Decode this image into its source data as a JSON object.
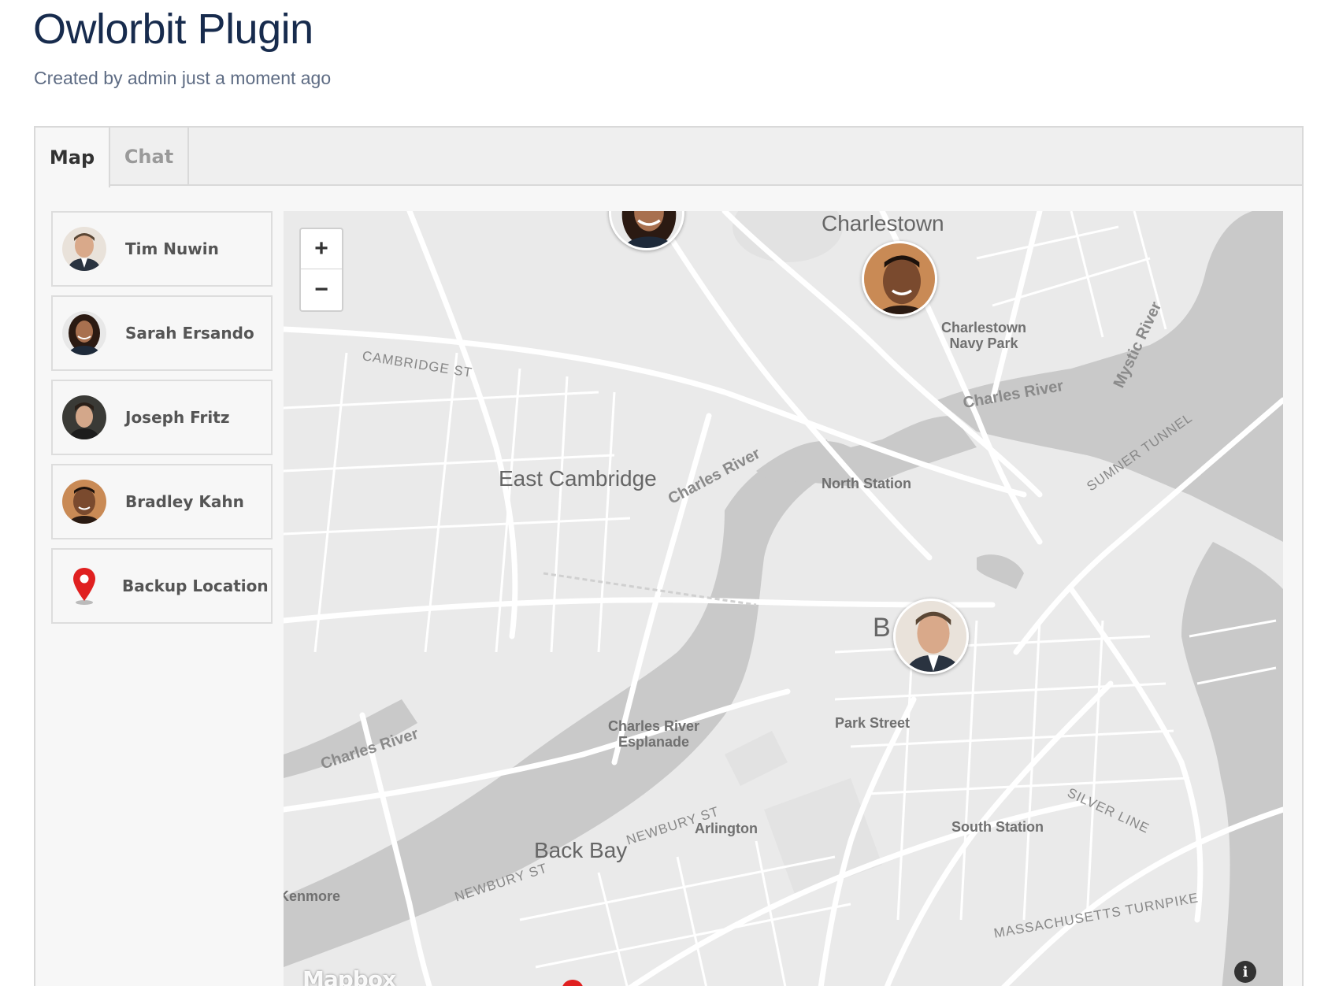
{
  "page": {
    "title": "Owlorbit Plugin",
    "meta": "Created by admin just a moment ago"
  },
  "tabs": [
    {
      "label": "Map",
      "active": true
    },
    {
      "label": "Chat",
      "active": false
    }
  ],
  "people": [
    {
      "name": "Tim Nuwin",
      "icon": "avatar"
    },
    {
      "name": "Sarah Ersando",
      "icon": "avatar"
    },
    {
      "name": "Joseph Fritz",
      "icon": "avatar"
    },
    {
      "name": "Bradley Kahn",
      "icon": "avatar"
    },
    {
      "name": "Backup Location",
      "icon": "location-pin-icon"
    }
  ],
  "map": {
    "zoom_in": "+",
    "zoom_out": "−",
    "attribution_logo": "Mapbox",
    "info_icon": "i",
    "labels": {
      "charlestown": "Charlestown",
      "charlestown_navy_park": "Charlestown Navy Park",
      "east_cambridge": "East Cambridge",
      "north_station": "North Station",
      "charles_river_1": "Charles River",
      "charles_river_2": "Charles River",
      "charles_river_3": "Charles River",
      "mystic_river": "Mystic River",
      "sumner_tunnel": "SUMNER TUNNEL",
      "cambridge_st": "CAMBRIDGE ST",
      "boston_partial": "B",
      "esplanade": "Charles River Esplanade",
      "park_street": "Park Street",
      "silver_line": "SILVER LINE",
      "back_bay": "Back Bay",
      "arlington": "Arlington",
      "newbury_st_1": "NEWBURY ST",
      "newbury_st_2": "NEWBURY ST",
      "south_station": "South Station",
      "kenmore": "Kenmore",
      "mass_turnpike": "MASSACHUSETTS TURNPIKE"
    },
    "colors": {
      "land": "#eaeaea",
      "water": "#c9c9c9",
      "road": "#ffffff",
      "pin": "#e02020"
    }
  }
}
